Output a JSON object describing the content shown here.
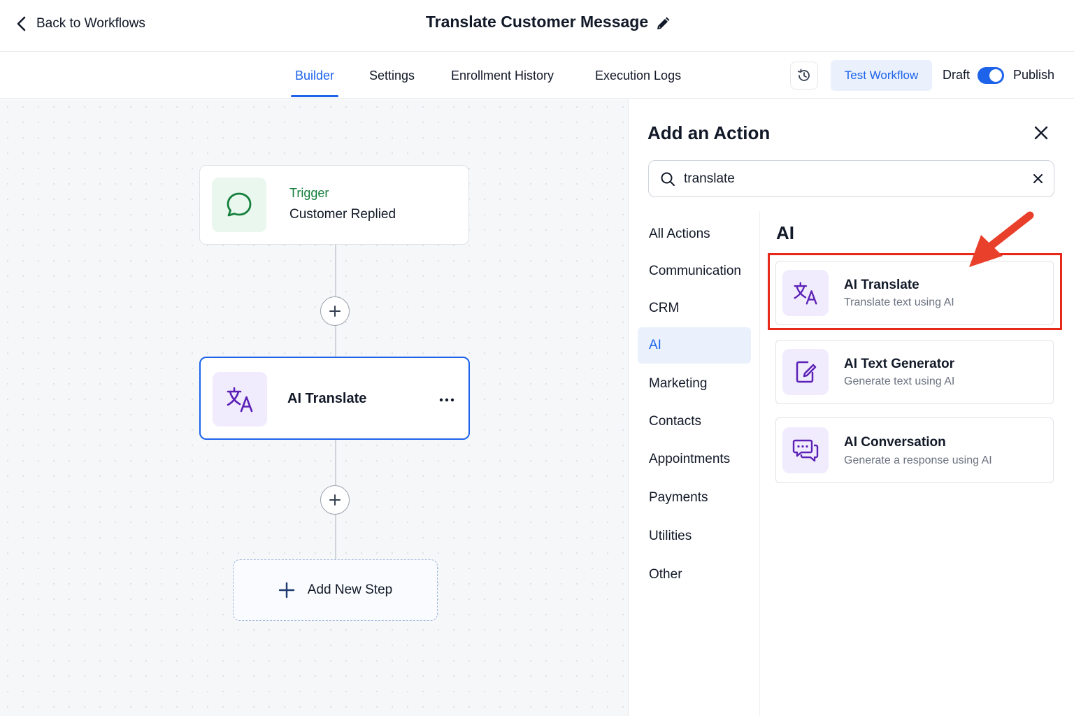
{
  "header": {
    "back_label": "Back to Workflows",
    "workflow_title": "Translate Customer Message"
  },
  "tabs": [
    {
      "label": "Builder",
      "active": true
    },
    {
      "label": "Settings",
      "active": false
    },
    {
      "label": "Enrollment History",
      "active": false
    },
    {
      "label": "Execution Logs",
      "active": false
    }
  ],
  "toolbar": {
    "test_label": "Test Workflow",
    "draft_label": "Draft",
    "publish_label": "Publish",
    "toggle_on": true
  },
  "canvas": {
    "trigger": {
      "kicker": "Trigger",
      "title": "Customer Replied"
    },
    "action_node": {
      "title": "AI Translate"
    },
    "add_step_label": "Add New Step"
  },
  "panel": {
    "title": "Add an Action",
    "search": {
      "value": "translate"
    },
    "categories": [
      {
        "label": "All Actions",
        "active": false
      },
      {
        "label": "Communication",
        "active": false
      },
      {
        "label": "CRM",
        "active": false
      },
      {
        "label": "AI",
        "active": true
      },
      {
        "label": "Marketing",
        "active": false
      },
      {
        "label": "Contacts",
        "active": false
      },
      {
        "label": "Appointments",
        "active": false
      },
      {
        "label": "Payments",
        "active": false
      },
      {
        "label": "Utilities",
        "active": false
      },
      {
        "label": "Other",
        "active": false
      }
    ],
    "section_heading": "AI",
    "actions": [
      {
        "title": "AI Translate",
        "description": "Translate text using AI",
        "icon": "translate-icon"
      },
      {
        "title": "AI Text Generator",
        "description": "Generate text using AI",
        "icon": "document-edit-icon"
      },
      {
        "title": "AI Conversation",
        "description": "Generate a response using AI",
        "icon": "chat-bubbles-icon"
      }
    ]
  },
  "colors": {
    "accent": "#1d63ea",
    "trigger_green": "#15803d",
    "ai_purple": "#5b21b6",
    "highlight_red": "#e8281b"
  }
}
